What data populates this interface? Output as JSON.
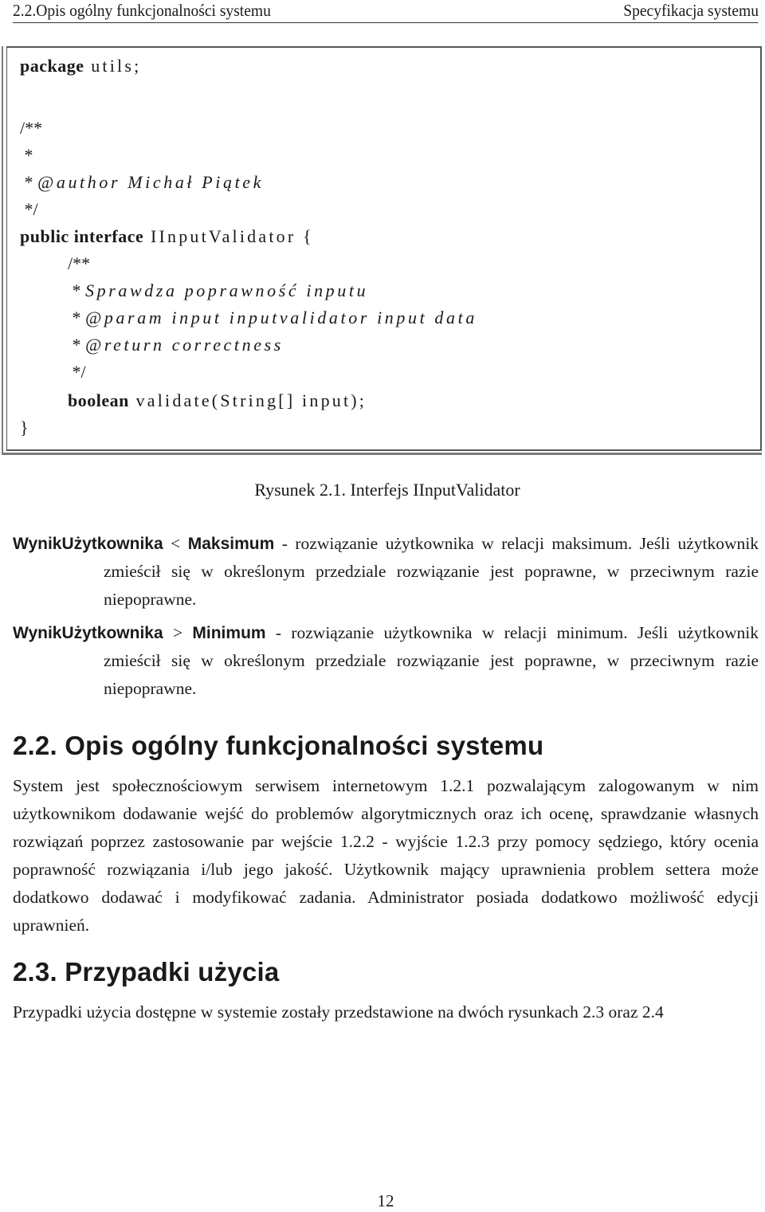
{
  "header": {
    "section": "2.2.Opis ogólny funkcjonalności systemu",
    "chapter": "Specyfikacja systemu"
  },
  "code": {
    "lines": [
      {
        "kw": "package",
        "text": " utils;"
      },
      {
        "text": "/**"
      },
      {
        "text": " *"
      },
      {
        "text": " * ",
        "italic": "@author Michał Piątek"
      },
      {
        "text": " */"
      },
      {
        "kw": "public interface",
        "text": " IInputValidator {"
      },
      {
        "text": "/**"
      },
      {
        "text": " * ",
        "italic": "Sprawdza poprawność inputu"
      },
      {
        "text": " * ",
        "italic": "@param input inputvalidator input data"
      },
      {
        "text": " * ",
        "italic": "@return correctness"
      },
      {
        "text": " */"
      },
      {
        "kw": "boolean",
        "text": " validate(String[] input);"
      },
      {
        "text": "}"
      }
    ]
  },
  "figure": {
    "caption": "Rysunek 2.1. Interfejs IInputValidator"
  },
  "definitions": [
    {
      "term_left": "WynikUżytkownika",
      "operator": " < ",
      "term_right": "Maksimum",
      "description": " - rozwiązanie użytkownika w relacji maksimum. Jeśli użytkownik zmieścił się w określonym przedziale rozwiązanie jest poprawne, w przeciwnym razie niepoprawne."
    },
    {
      "term_left": "WynikUżytkownika",
      "operator": " > ",
      "term_right": "Minimum",
      "description": " - rozwiązanie użytkownika w relacji minimum. Jeśli użytkownik zmieścił się w określonym przedziale rozwiązanie jest poprawne, w przeciwnym razie niepoprawne."
    }
  ],
  "sections": [
    {
      "number": "2.2.",
      "title": "Opis ogólny funkcjonalności systemu",
      "body": "System jest społecznościowym serwisem internetowym 1.2.1 pozwalającym zalogowanym w nim użytkownikom dodawanie wejść do problemów algorytmicznych oraz ich ocenę, sprawdzanie własnych rozwiązań poprzez zastosowanie par wejście 1.2.2 - wyjście 1.2.3 przy pomocy sędziego, który ocenia poprawność rozwiązania i/lub jego jakość. Użytkownik mający uprawnienia problem settera może dodatkowo dodawać i modyfikować zadania. Administrator posiada dodatkowo możliwość edycji uprawnień."
    },
    {
      "number": "2.3.",
      "title": "Przypadki użycia",
      "body": "Przypadki użycia dostępne w systemie zostały przedstawione na dwóch rysunkach  2.3 oraz 2.4"
    }
  ],
  "footer": {
    "page_number": "12"
  }
}
